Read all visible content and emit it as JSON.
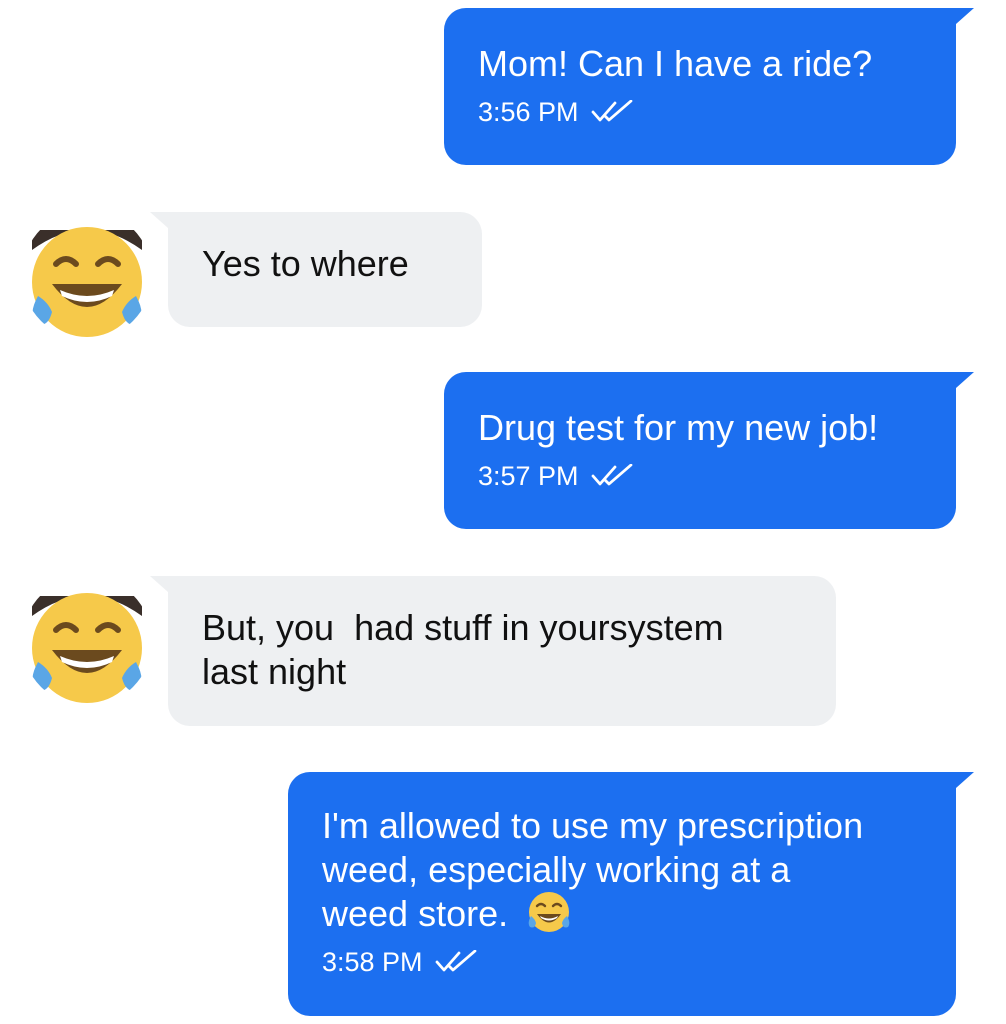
{
  "colors": {
    "outgoing_bubble": "#1c6ff0",
    "incoming_bubble": "#eef0f2",
    "emoji_face": "#f6c94a",
    "emoji_tear": "#5aa6e6"
  },
  "messages": [
    {
      "direction": "outgoing",
      "text": "Mom! Can I have a ride?",
      "time": "3:56 PM",
      "status_icon": "double-check-icon"
    },
    {
      "direction": "incoming",
      "text": "Yes to where",
      "avatar_icon": "face-with-tears-of-joy-icon"
    },
    {
      "direction": "outgoing",
      "text": "Drug test for my new job!",
      "time": "3:57 PM",
      "status_icon": "double-check-icon"
    },
    {
      "direction": "incoming",
      "line1": "But, you  had stuff in yoursystem",
      "line2": "last night",
      "avatar_icon": "face-with-tears-of-joy-icon"
    },
    {
      "direction": "outgoing",
      "line1": "I'm allowed to use my prescription",
      "line2": "weed, especially working at a",
      "line3": "weed store.",
      "emoji": "face-with-tears-of-joy-icon",
      "time": "3:58 PM",
      "status_icon": "double-check-icon"
    }
  ]
}
